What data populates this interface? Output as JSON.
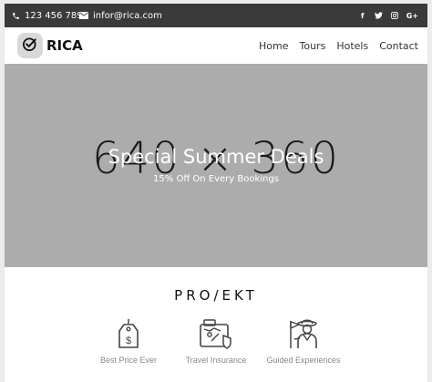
{
  "topbar": {
    "phone": "123 456 789",
    "email": "infor@rica.com",
    "social": [
      {
        "icon": "facebook-icon",
        "glyph": "f"
      },
      {
        "icon": "twitter-icon",
        "glyph": "❖"
      },
      {
        "icon": "instagram-icon",
        "glyph": "▣"
      },
      {
        "icon": "google-plus-icon",
        "glyph": "G+"
      }
    ]
  },
  "header": {
    "brand": "RICA",
    "logo_icon": "check-circle-icon",
    "nav": [
      "Home",
      "Tours",
      "Hotels",
      "Contact"
    ]
  },
  "hero": {
    "placeholder_text": "640 × 360",
    "title": "Special Summer Deals",
    "subtitle": "15% Off On Every Bookings"
  },
  "section": {
    "title": "PRO/EKT",
    "features": [
      {
        "icon": "price-tag-icon",
        "label": "Best Price Ever"
      },
      {
        "icon": "travel-map-icon",
        "label": "Travel Insurance"
      },
      {
        "icon": "guide-icon",
        "label": "Guided Experiences"
      }
    ]
  },
  "colors": {
    "topbar": "#3a3a3a",
    "hero_bg": "#acacac",
    "logo_bg": "#d8d8d8"
  }
}
